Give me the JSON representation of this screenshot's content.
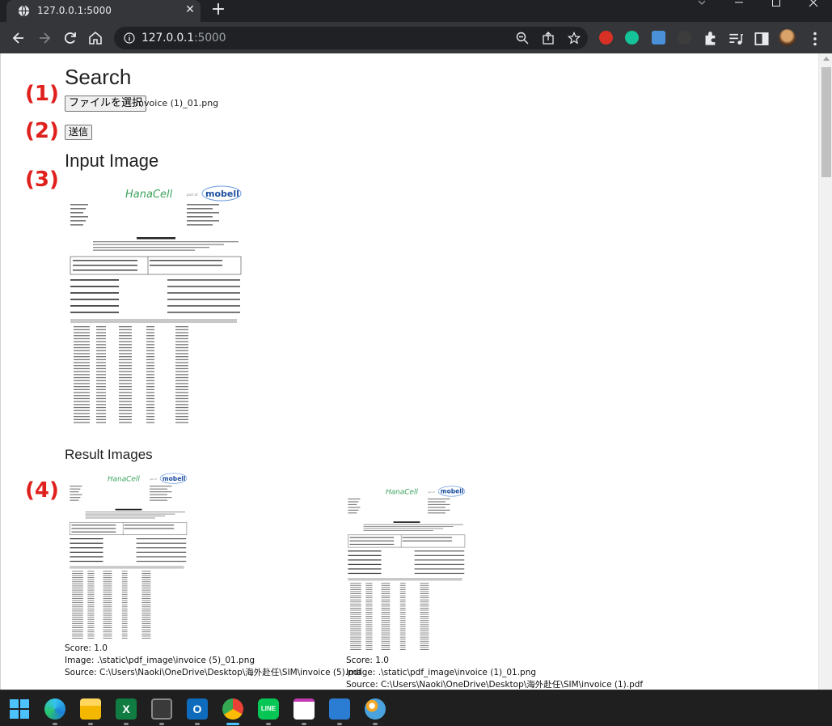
{
  "browser": {
    "tab_title": "127.0.0.1:5000",
    "url_host": "127.0.0.1",
    "url_port": ":5000"
  },
  "page": {
    "search_heading": "Search",
    "file_button_label": "ファイルを選択",
    "file_name": "invoice (1)_01.png",
    "submit_label": "送信",
    "input_heading": "Input Image",
    "result_heading": "Result Images"
  },
  "annotations": [
    "(1)",
    "(2)",
    "(3)",
    "(4)"
  ],
  "document": {
    "logo_left": "HanaCell",
    "logo_part_of": "part of",
    "logo_right": "mobell"
  },
  "results": [
    {
      "score": "Score: 1.0",
      "image": "Image: .\\static\\pdf_image\\invoice (5)_01.png",
      "source": "Source: C:\\Users\\Naoki\\OneDrive\\Desktop\\海外赴任\\SIM\\invoice (5).pdf"
    },
    {
      "score": "Score: 1.0",
      "image": "Image: .\\static\\pdf_image\\invoice (1)_01.png",
      "source": "Source: C:\\Users\\Naoki\\OneDrive\\Desktop\\海外赴任\\SIM\\invoice (1).pdf"
    }
  ],
  "colors": {
    "annotation_red": "#e0201c",
    "hanacell_green": "#3aa35b",
    "mobell_blue": "#1e4fa0"
  }
}
